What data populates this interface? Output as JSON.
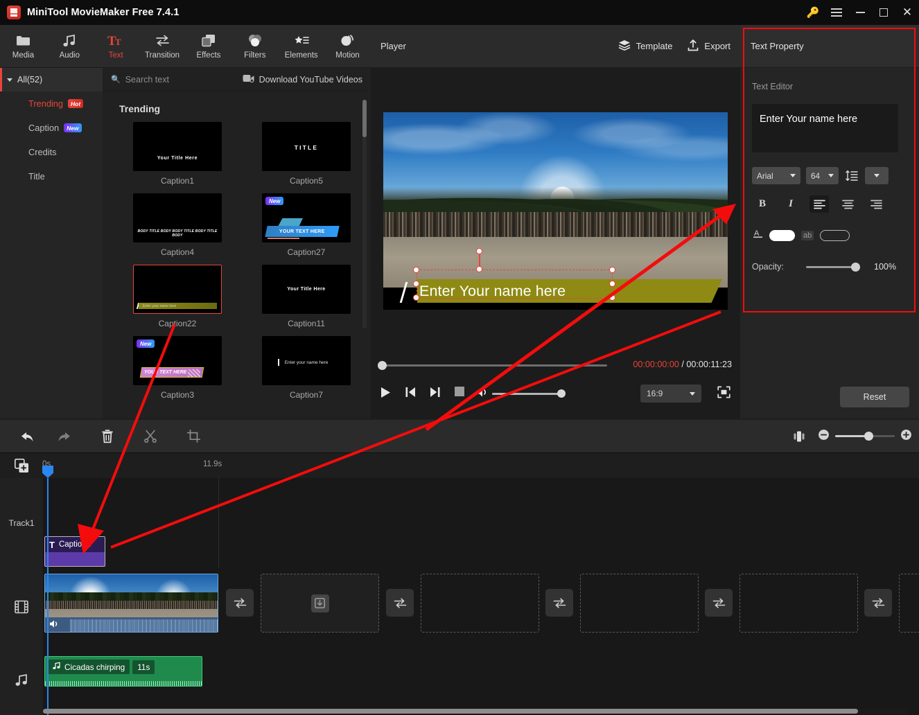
{
  "titlebar": {
    "app_title": "MiniTool MovieMaker Free 7.4.1",
    "key_icon": "key-icon",
    "menu_icon": "hamburger-menu-icon",
    "minimize": "minimize-icon",
    "maximize": "maximize-icon",
    "close": "close-icon"
  },
  "toolbar": {
    "items": [
      {
        "label": "Media",
        "icon": "folder-icon",
        "active": false
      },
      {
        "label": "Audio",
        "icon": "music-note-icon",
        "active": false
      },
      {
        "label": "Text",
        "icon": "text-tt-icon",
        "active": true
      },
      {
        "label": "Transition",
        "icon": "transition-arrows-icon",
        "active": false
      },
      {
        "label": "Effects",
        "icon": "effects-squares-icon",
        "active": false
      },
      {
        "label": "Filters",
        "icon": "filters-circles-icon",
        "active": false
      },
      {
        "label": "Elements",
        "icon": "elements-star-list-icon",
        "active": false
      },
      {
        "label": "Motion",
        "icon": "motion-sphere-icon",
        "active": false
      }
    ]
  },
  "library": {
    "all_label": "All(52)",
    "categories": [
      {
        "label": "Trending",
        "badge": "Hot",
        "badge_type": "hot",
        "selected": true
      },
      {
        "label": "Caption",
        "badge": "New",
        "badge_type": "new",
        "selected": false
      },
      {
        "label": "Credits",
        "badge": "",
        "badge_type": "",
        "selected": false
      },
      {
        "label": "Title",
        "badge": "",
        "badge_type": "",
        "selected": false
      }
    ],
    "search_placeholder": "Search text",
    "search_value": "",
    "search_icon": "search-icon",
    "youtube_label": "Download YouTube Videos",
    "youtube_icon": "youtube-download-icon",
    "section_title": "Trending",
    "templates": [
      {
        "name": "Caption1",
        "preview_text": "Your  Title Here",
        "style": "c1",
        "badge": "",
        "selected": false
      },
      {
        "name": "Caption5",
        "preview_text": "TITLE",
        "style": "c5",
        "badge": "",
        "selected": false
      },
      {
        "name": "Caption4",
        "preview_text": "BODY TITLE BODY BODY TITLE BODY TITLE BODY",
        "style": "c4",
        "badge": "",
        "selected": false
      },
      {
        "name": "Caption27",
        "preview_text": "YOUR TEXT HERE",
        "style": "c27",
        "badge": "New",
        "selected": false
      },
      {
        "name": "Caption22",
        "preview_text": "Enter your name here",
        "style": "c22",
        "badge": "",
        "selected": true
      },
      {
        "name": "Caption11",
        "preview_text": "Your  Title Here",
        "style": "c11",
        "badge": "",
        "selected": false
      },
      {
        "name": "Caption3",
        "preview_text": "YOUR TEXT HERE",
        "style": "c3",
        "badge": "New",
        "selected": false
      },
      {
        "name": "Caption7",
        "preview_text": "Enter your name here",
        "style": "c7",
        "badge": "",
        "selected": false
      }
    ]
  },
  "player": {
    "title": "Player",
    "template_label": "Template",
    "template_icon": "layers-icon",
    "export_label": "Export",
    "export_icon": "export-upload-icon",
    "caption_overlay_text": "Enter Your name here",
    "current_time": "00:00:00:00",
    "time_separator": " / ",
    "total_time": "00:00:11:23",
    "play_icon": "play-icon",
    "prev_icon": "previous-frame-icon",
    "next_icon": "next-frame-icon",
    "stop_icon": "stop-icon",
    "volume_icon": "volume-icon",
    "aspect_ratio": "16:9",
    "fullscreen_icon": "fullscreen-icon",
    "accent_color": "#e8453c",
    "caption_band_color": "#8e8a13"
  },
  "text_property": {
    "panel_title": "Text Property",
    "section_label": "Text Editor",
    "editor_value": "Enter Your name here",
    "font_family": "Arial",
    "font_size": "64",
    "line_spacing_icon": "line-spacing-icon",
    "more_icon": "chevron-down-icon",
    "bold_label": "B",
    "italic_label": "I",
    "align_left_icon": "align-left-icon",
    "align_center_icon": "align-center-icon",
    "align_right_icon": "align-right-icon",
    "text_color_icon": "text-color-A-icon",
    "text_color": "#ffffff",
    "outline_icon": "outline-ab-icon",
    "outline_color": "transparent",
    "opacity_label": "Opacity:",
    "opacity_value": "100%",
    "reset_label": "Reset",
    "highlight_border_color": "#f40c0c"
  },
  "timeline": {
    "tools": [
      {
        "icon": "undo-icon",
        "name": "undo-button",
        "dim": false
      },
      {
        "icon": "redo-icon",
        "name": "redo-button",
        "dim": true
      },
      {
        "icon": "delete-icon",
        "name": "delete-button",
        "dim": false
      },
      {
        "icon": "split-icon",
        "name": "split-button",
        "dim": true
      },
      {
        "icon": "crop-icon",
        "name": "crop-button",
        "dim": true
      }
    ],
    "split_view_icon": "split-view-icon",
    "zoom_out_icon": "zoom-out-icon",
    "zoom_in_icon": "zoom-in-icon",
    "add_track_icon": "add-media-icon",
    "ruler_start": "0s",
    "ruler_end": "11.9s",
    "track1_label": "Track1",
    "video_track_icon": "film-strip-icon",
    "audio_track_icon": "music-note-icon",
    "text_clip": {
      "label": "Caption2",
      "icon": "text-T-icon"
    },
    "video_clip": {
      "speaker_icon": "volume-icon"
    },
    "audio_clip": {
      "icon": "music-note-icon",
      "label": "Cicadas chirping",
      "duration": "11s"
    },
    "transition_icon": "transition-arrows-icon",
    "dropzone_icon": "download-box-icon"
  }
}
